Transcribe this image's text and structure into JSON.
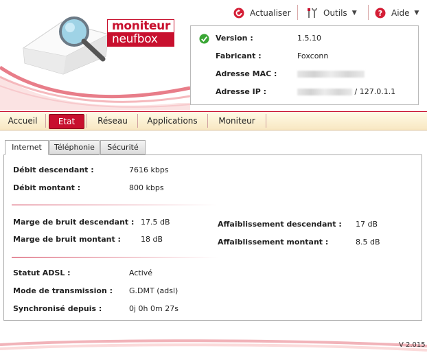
{
  "toolbar": {
    "refresh_label": "Actualiser",
    "tools_label": "Outils",
    "help_label": "Aide"
  },
  "logo": {
    "top": "moniteur",
    "bottom": "neufbox"
  },
  "info": {
    "version_label": "Version :",
    "version_value": "1.5.10",
    "maker_label": "Fabricant :",
    "maker_value": "Foxconn",
    "mac_label": "Adresse MAC :",
    "ip_label": "Adresse IP :",
    "ip_suffix": "/ 127.0.1.1"
  },
  "nav": {
    "items": [
      "Accueil",
      "Etat",
      "Réseau",
      "Applications",
      "Moniteur"
    ],
    "active": "Etat"
  },
  "tabs": [
    "Internet",
    "Téléphonie",
    "Sécurité"
  ],
  "internet": {
    "down_rate_label": "Débit descendant :",
    "down_rate_value": "7616 kbps",
    "up_rate_label": "Débit montant :",
    "up_rate_value": "800 kbps",
    "snr_down_label": "Marge de bruit descendant :",
    "snr_down_value": "17.5 dB",
    "snr_up_label": "Marge de bruit montant :",
    "snr_up_value": "18 dB",
    "atten_down_label": "Affaiblissement descendant :",
    "atten_down_value": "17 dB",
    "atten_up_label": "Affaiblissement montant :",
    "atten_up_value": "8.5 dB",
    "adsl_status_label": "Statut ADSL :",
    "adsl_status_value": "Activé",
    "mode_label": "Mode de transmission :",
    "mode_value": "G.DMT (adsl)",
    "sync_label": "Synchronisé depuis :",
    "sync_value": "0j 0h 0m 27s"
  },
  "footer": {
    "version": "V 2.015"
  },
  "colors": {
    "brand_red": "#c8102e",
    "ok_green": "#3aa635"
  }
}
